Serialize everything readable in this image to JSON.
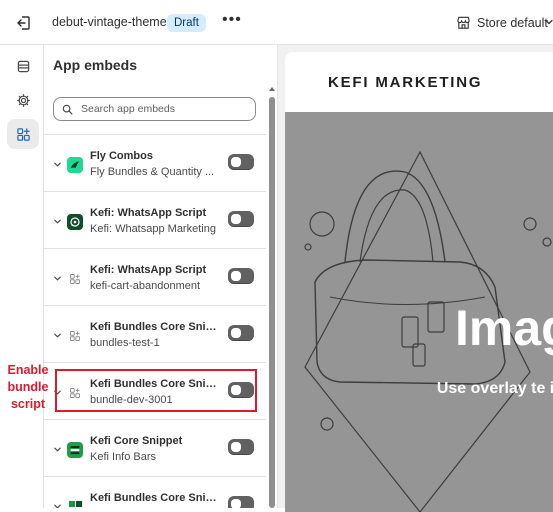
{
  "topbar": {
    "theme_name": "debut-vintage-theme",
    "status_badge": "Draft",
    "more_label": "•••",
    "store_selector": "Store default"
  },
  "panel": {
    "title": "App embeds",
    "search_placeholder": "Search app embeds",
    "items": [
      {
        "name": "Fly Combos",
        "subtitle": "Fly Bundles & Quantity ...",
        "icon": "fly-combos-icon",
        "enabled": false
      },
      {
        "name": "Kefi: WhatsApp Script",
        "subtitle": "Kefi: Whatsapp Marketing",
        "icon": "whatsapp-icon",
        "enabled": false
      },
      {
        "name": "Kefi: WhatsApp Script",
        "subtitle": "kefi-cart-abandonment",
        "icon": "app-block-icon",
        "enabled": false
      },
      {
        "name": "Kefi Bundles Core Snip...",
        "subtitle": "bundles-test-1",
        "icon": "app-block-icon",
        "enabled": false
      },
      {
        "name": "Kefi Bundles Core Snip...",
        "subtitle": "bundle-dev-3001",
        "icon": "app-block-icon",
        "enabled": false
      },
      {
        "name": "Kefi Core Snippet",
        "subtitle": "Kefi Info Bars",
        "icon": "info-bars-icon",
        "enabled": false
      },
      {
        "name": "Kefi Bundles Core Snip...",
        "subtitle": "",
        "icon": "bundles-icon",
        "enabled": false
      }
    ]
  },
  "annotation": {
    "label": "Enable\nbundle\nscript",
    "color": "#e0192d"
  },
  "preview": {
    "brand": "KEFI MARKETING",
    "hero_title": "Imag",
    "hero_subtitle": "Use overlay te imag"
  },
  "colors": {
    "accent_badge_bg": "#d5ebff",
    "toggle_off": "#616161",
    "hero_bg": "#959595"
  }
}
